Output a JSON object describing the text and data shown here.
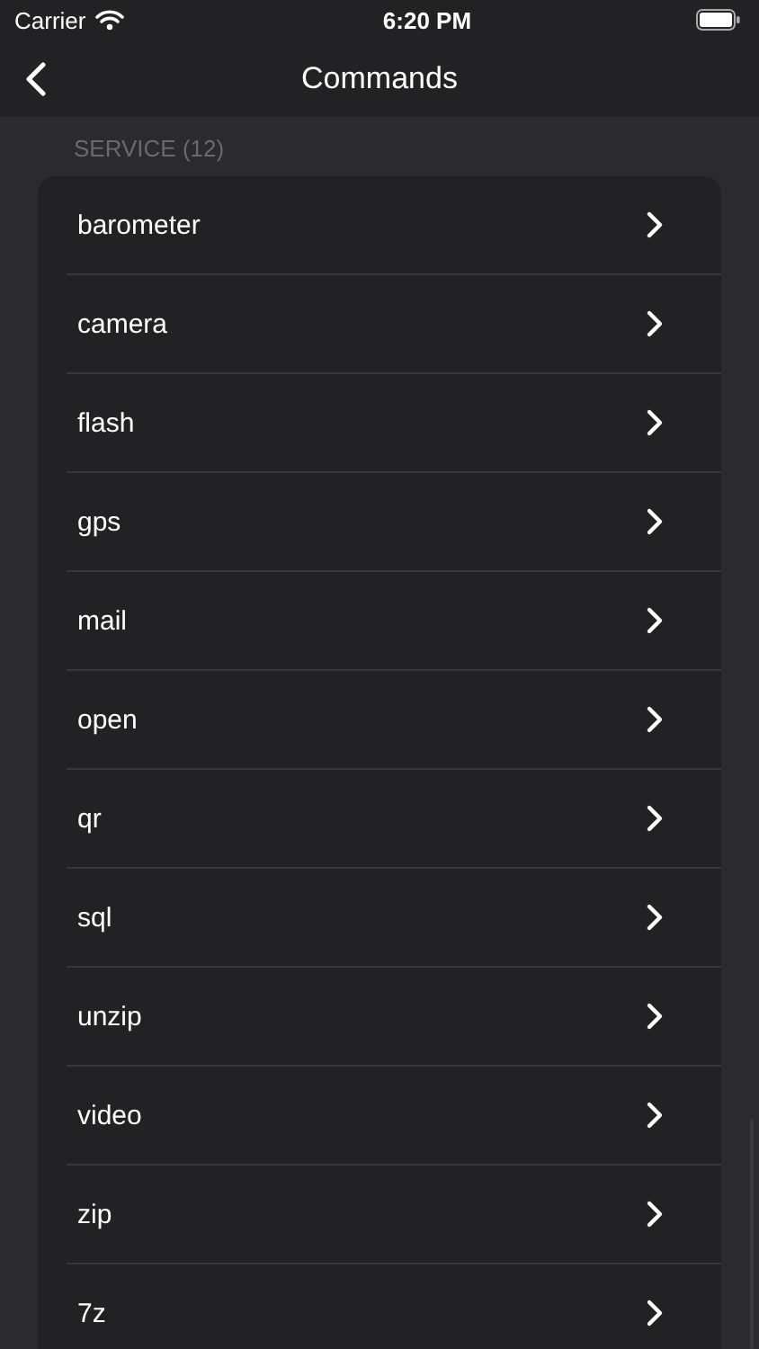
{
  "status_bar": {
    "carrier": "Carrier",
    "time": "6:20 PM"
  },
  "nav": {
    "title": "Commands"
  },
  "section": {
    "header": "SERVICE (12)",
    "items": [
      {
        "label": "barometer"
      },
      {
        "label": "camera"
      },
      {
        "label": "flash"
      },
      {
        "label": "gps"
      },
      {
        "label": "mail"
      },
      {
        "label": "open"
      },
      {
        "label": "qr"
      },
      {
        "label": "sql"
      },
      {
        "label": "unzip"
      },
      {
        "label": "video"
      },
      {
        "label": "zip"
      },
      {
        "label": "7z"
      }
    ]
  }
}
